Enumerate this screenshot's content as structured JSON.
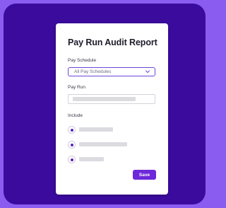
{
  "form": {
    "title": "Pay Run Audit Report",
    "pay_schedule": {
      "label": "Pay Schedule",
      "selected_value": "All Pay Schedules"
    },
    "pay_run": {
      "label": "Pay Run",
      "value": ""
    },
    "include": {
      "label": "Include",
      "options": [
        {
          "label": "",
          "selected": true
        },
        {
          "label": "",
          "selected": true
        },
        {
          "label": "",
          "selected": true
        }
      ]
    },
    "save_label": "Save"
  },
  "icons": {
    "dropdown": "chevron-down-icon",
    "radio_selected": "radio-selected-icon"
  },
  "colors": {
    "page_background": "#8b5cf0",
    "panel_background": "#3a0b9c",
    "accent": "#6d28d9",
    "card_background": "#ffffff"
  }
}
